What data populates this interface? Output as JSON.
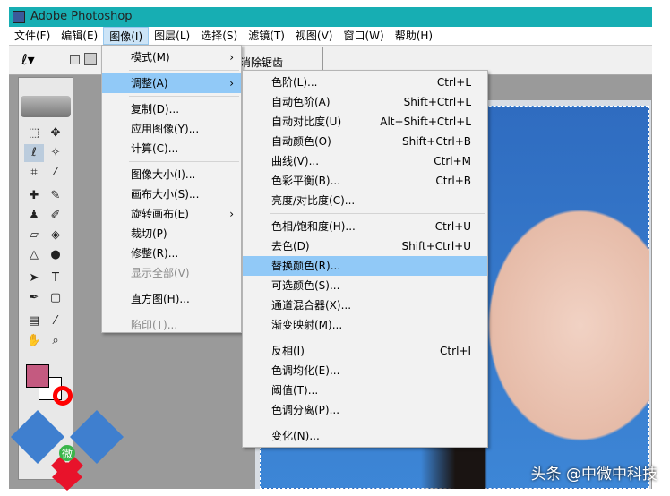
{
  "window": {
    "title": "Adobe Photoshop"
  },
  "menubar": [
    "文件(F)",
    "编辑(E)",
    "图像(I)",
    "图层(L)",
    "选择(S)",
    "滤镜(T)",
    "视图(V)",
    "窗口(W)",
    "帮助(H)"
  ],
  "toolbar": {
    "antialias_label": "消除锯齿"
  },
  "image_menu": [
    {
      "label": "模式(M)",
      "submenu": true
    },
    {
      "sep": true
    },
    {
      "label": "调整(A)",
      "submenu": true,
      "highlighted": true
    },
    {
      "sep": true
    },
    {
      "label": "复制(D)..."
    },
    {
      "label": "应用图像(Y)..."
    },
    {
      "label": "计算(C)..."
    },
    {
      "sep": true
    },
    {
      "label": "图像大小(I)..."
    },
    {
      "label": "画布大小(S)..."
    },
    {
      "label": "旋转画布(E)",
      "submenu": true
    },
    {
      "label": "裁切(P)"
    },
    {
      "label": "修整(R)..."
    },
    {
      "label": "显示全部(V)",
      "disabled": true
    },
    {
      "sep": true
    },
    {
      "label": "直方图(H)..."
    },
    {
      "sep": true
    },
    {
      "label": "陷印(T)...",
      "disabled": true
    }
  ],
  "adjust_menu": [
    {
      "label": "色阶(L)...",
      "shortcut": "Ctrl+L"
    },
    {
      "label": "自动色阶(A)",
      "shortcut": "Shift+Ctrl+L"
    },
    {
      "label": "自动对比度(U)",
      "shortcut": "Alt+Shift+Ctrl+L"
    },
    {
      "label": "自动颜色(O)",
      "shortcut": "Shift+Ctrl+B"
    },
    {
      "label": "曲线(V)...",
      "shortcut": "Ctrl+M"
    },
    {
      "label": "色彩平衡(B)...",
      "shortcut": "Ctrl+B"
    },
    {
      "label": "亮度/对比度(C)..."
    },
    {
      "sep": true
    },
    {
      "label": "色相/饱和度(H)...",
      "shortcut": "Ctrl+U"
    },
    {
      "label": "去色(D)",
      "shortcut": "Shift+Ctrl+U"
    },
    {
      "label": "替换颜色(R)...",
      "highlighted": true
    },
    {
      "label": "可选颜色(S)..."
    },
    {
      "label": "通道混合器(X)..."
    },
    {
      "label": "渐变映射(M)..."
    },
    {
      "sep": true
    },
    {
      "label": "反相(I)",
      "shortcut": "Ctrl+I"
    },
    {
      "label": "色调均化(E)..."
    },
    {
      "label": "阈值(T)..."
    },
    {
      "label": "色调分离(P)..."
    },
    {
      "sep": true
    },
    {
      "label": "变化(N)..."
    }
  ],
  "colors": {
    "foreground": "#c45a80",
    "background": "#ffffff",
    "highlight": "#91c9f7",
    "titlebar": "#17aeb3"
  },
  "logo_text": "微",
  "watermark": "头条 @中微中科技"
}
